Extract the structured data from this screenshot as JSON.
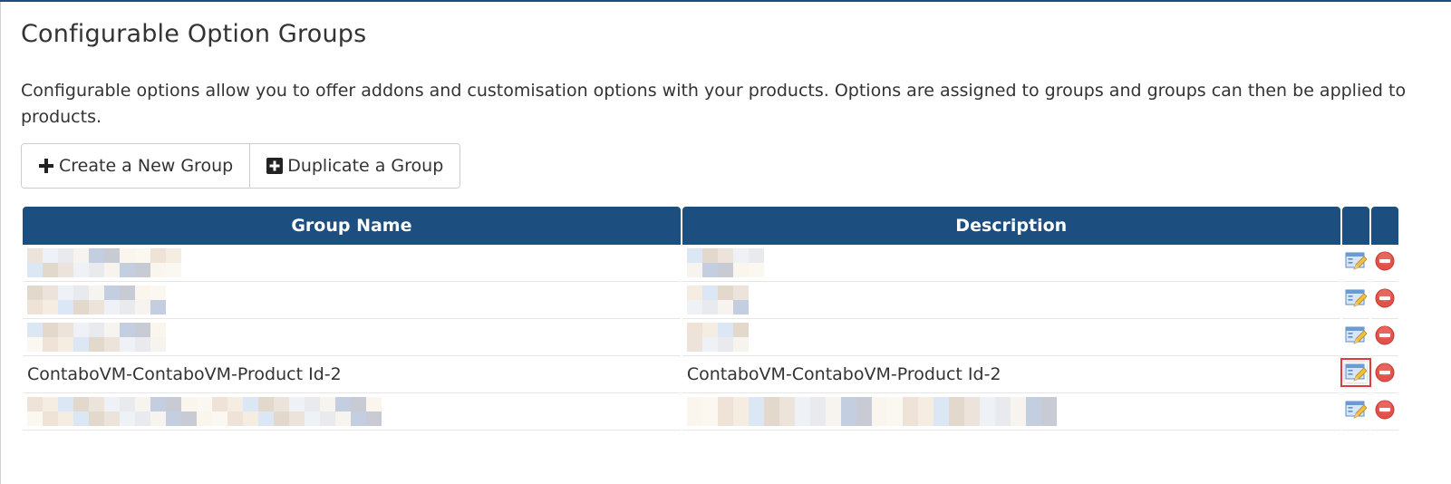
{
  "page": {
    "title": "Configurable Option Groups",
    "intro": "Configurable options allow you to offer addons and customisation options with your products. Options are assigned to groups and groups can then be applied to products."
  },
  "toolbar": {
    "create_label": "Create a New Group",
    "create_icon": "plus-icon",
    "duplicate_label": "Duplicate a Group",
    "duplicate_icon": "plus-square-icon"
  },
  "table": {
    "columns": [
      "Group Name",
      "Description",
      "",
      ""
    ],
    "rows": [
      {
        "group_name": "[redacted]",
        "description": "[redacted]",
        "redacted": true
      },
      {
        "group_name": "[redacted]",
        "description": "[redacted]",
        "redacted": true
      },
      {
        "group_name": "[redacted]",
        "description": "[redacted]",
        "redacted": true
      },
      {
        "group_name": "ContaboVM-ContaboVM-Product Id-2",
        "description": "ContaboVM-ContaboVM-Product Id-2",
        "redacted": false,
        "edit_highlighted": true
      },
      {
        "group_name": "[redacted]",
        "description": "[redacted]",
        "redacted": true
      }
    ],
    "row_actions": {
      "edit_icon": "edit-icon",
      "delete_icon": "delete-icon"
    }
  },
  "colors": {
    "header_bg": "#1c4f80",
    "accent_bar": "#1a4d80",
    "delete_red": "#e0524a",
    "highlight_red": "#e03c3c"
  }
}
